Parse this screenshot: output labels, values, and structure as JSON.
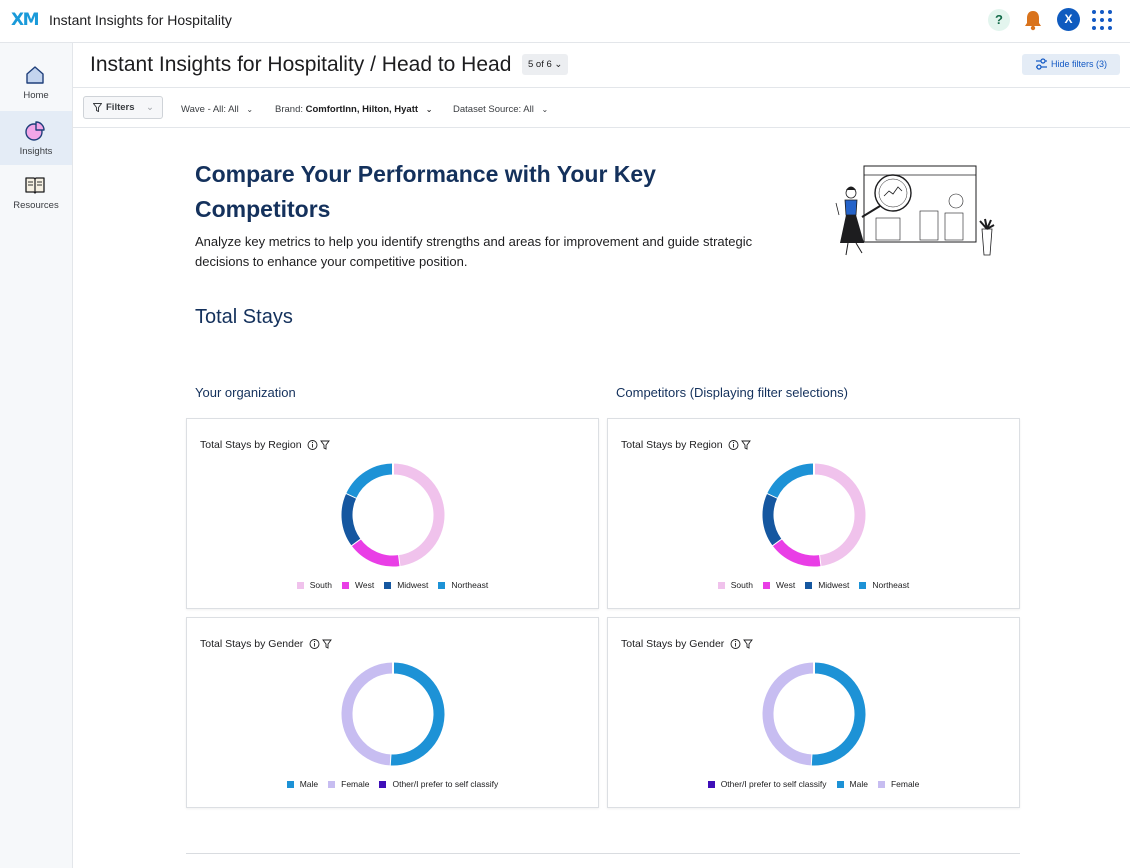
{
  "app": {
    "logo": "XM",
    "title": "Instant Insights for Hospitality",
    "avatar_initial": "X",
    "help_label": "?"
  },
  "sidenav": {
    "items": [
      {
        "label": "Home",
        "icon": "home-icon"
      },
      {
        "label": "Insights",
        "icon": "pie-chart-icon",
        "active": true
      },
      {
        "label": "Resources",
        "icon": "book-icon"
      }
    ]
  },
  "header": {
    "title": "Instant Insights for Hospitality / Head to Head",
    "page_count": "5 of 6",
    "hide_filters": "Hide filters (3)"
  },
  "filters": {
    "button_label": "Filters",
    "wave_label": "Wave - All:",
    "wave_value": "All",
    "brand_label": "Brand:",
    "brand_value": "ComfortInn, Hilton, Hyatt",
    "source_label": "Dataset Source:",
    "source_value": "All"
  },
  "hero": {
    "title": "Compare Your Performance with Your Key Competitors",
    "description": "Analyze key metrics to help you identify strengths and areas for improvement and guide strategic decisions to enhance your competitive position."
  },
  "section": {
    "title": "Total Stays",
    "org_heading": "Your organization",
    "comp_heading": "Competitors (Displaying filter selections)"
  },
  "colors": {
    "south": "#f0c2ec",
    "west": "#e93ee6",
    "midwest": "#1557a0",
    "northeast": "#1d92d6",
    "male": "#1d92d6",
    "female": "#c7bdf1",
    "other": "#3f0fb8"
  },
  "chart_data": [
    {
      "type": "pie",
      "title": "Total Stays by Region",
      "panel": "Your organization",
      "categories": [
        "South",
        "West",
        "Midwest",
        "Northeast"
      ],
      "values": [
        48,
        17,
        17,
        18
      ]
    },
    {
      "type": "pie",
      "title": "Total Stays by Gender",
      "panel": "Your organization",
      "categories": [
        "Male",
        "Female",
        "Other/I prefer to self classify"
      ],
      "values": [
        51,
        49,
        0
      ]
    },
    {
      "type": "pie",
      "title": "Total Stays by Region",
      "panel": "Competitors (Displaying filter selections)",
      "categories": [
        "South",
        "West",
        "Midwest",
        "Northeast"
      ],
      "values": [
        48,
        17,
        17,
        18
      ]
    },
    {
      "type": "pie",
      "title": "Total Stays by Gender",
      "panel": "Competitors (Displaying filter selections)",
      "categories": [
        "Other/I prefer to self classify",
        "Male",
        "Female"
      ],
      "values": [
        0,
        51,
        49
      ]
    }
  ]
}
